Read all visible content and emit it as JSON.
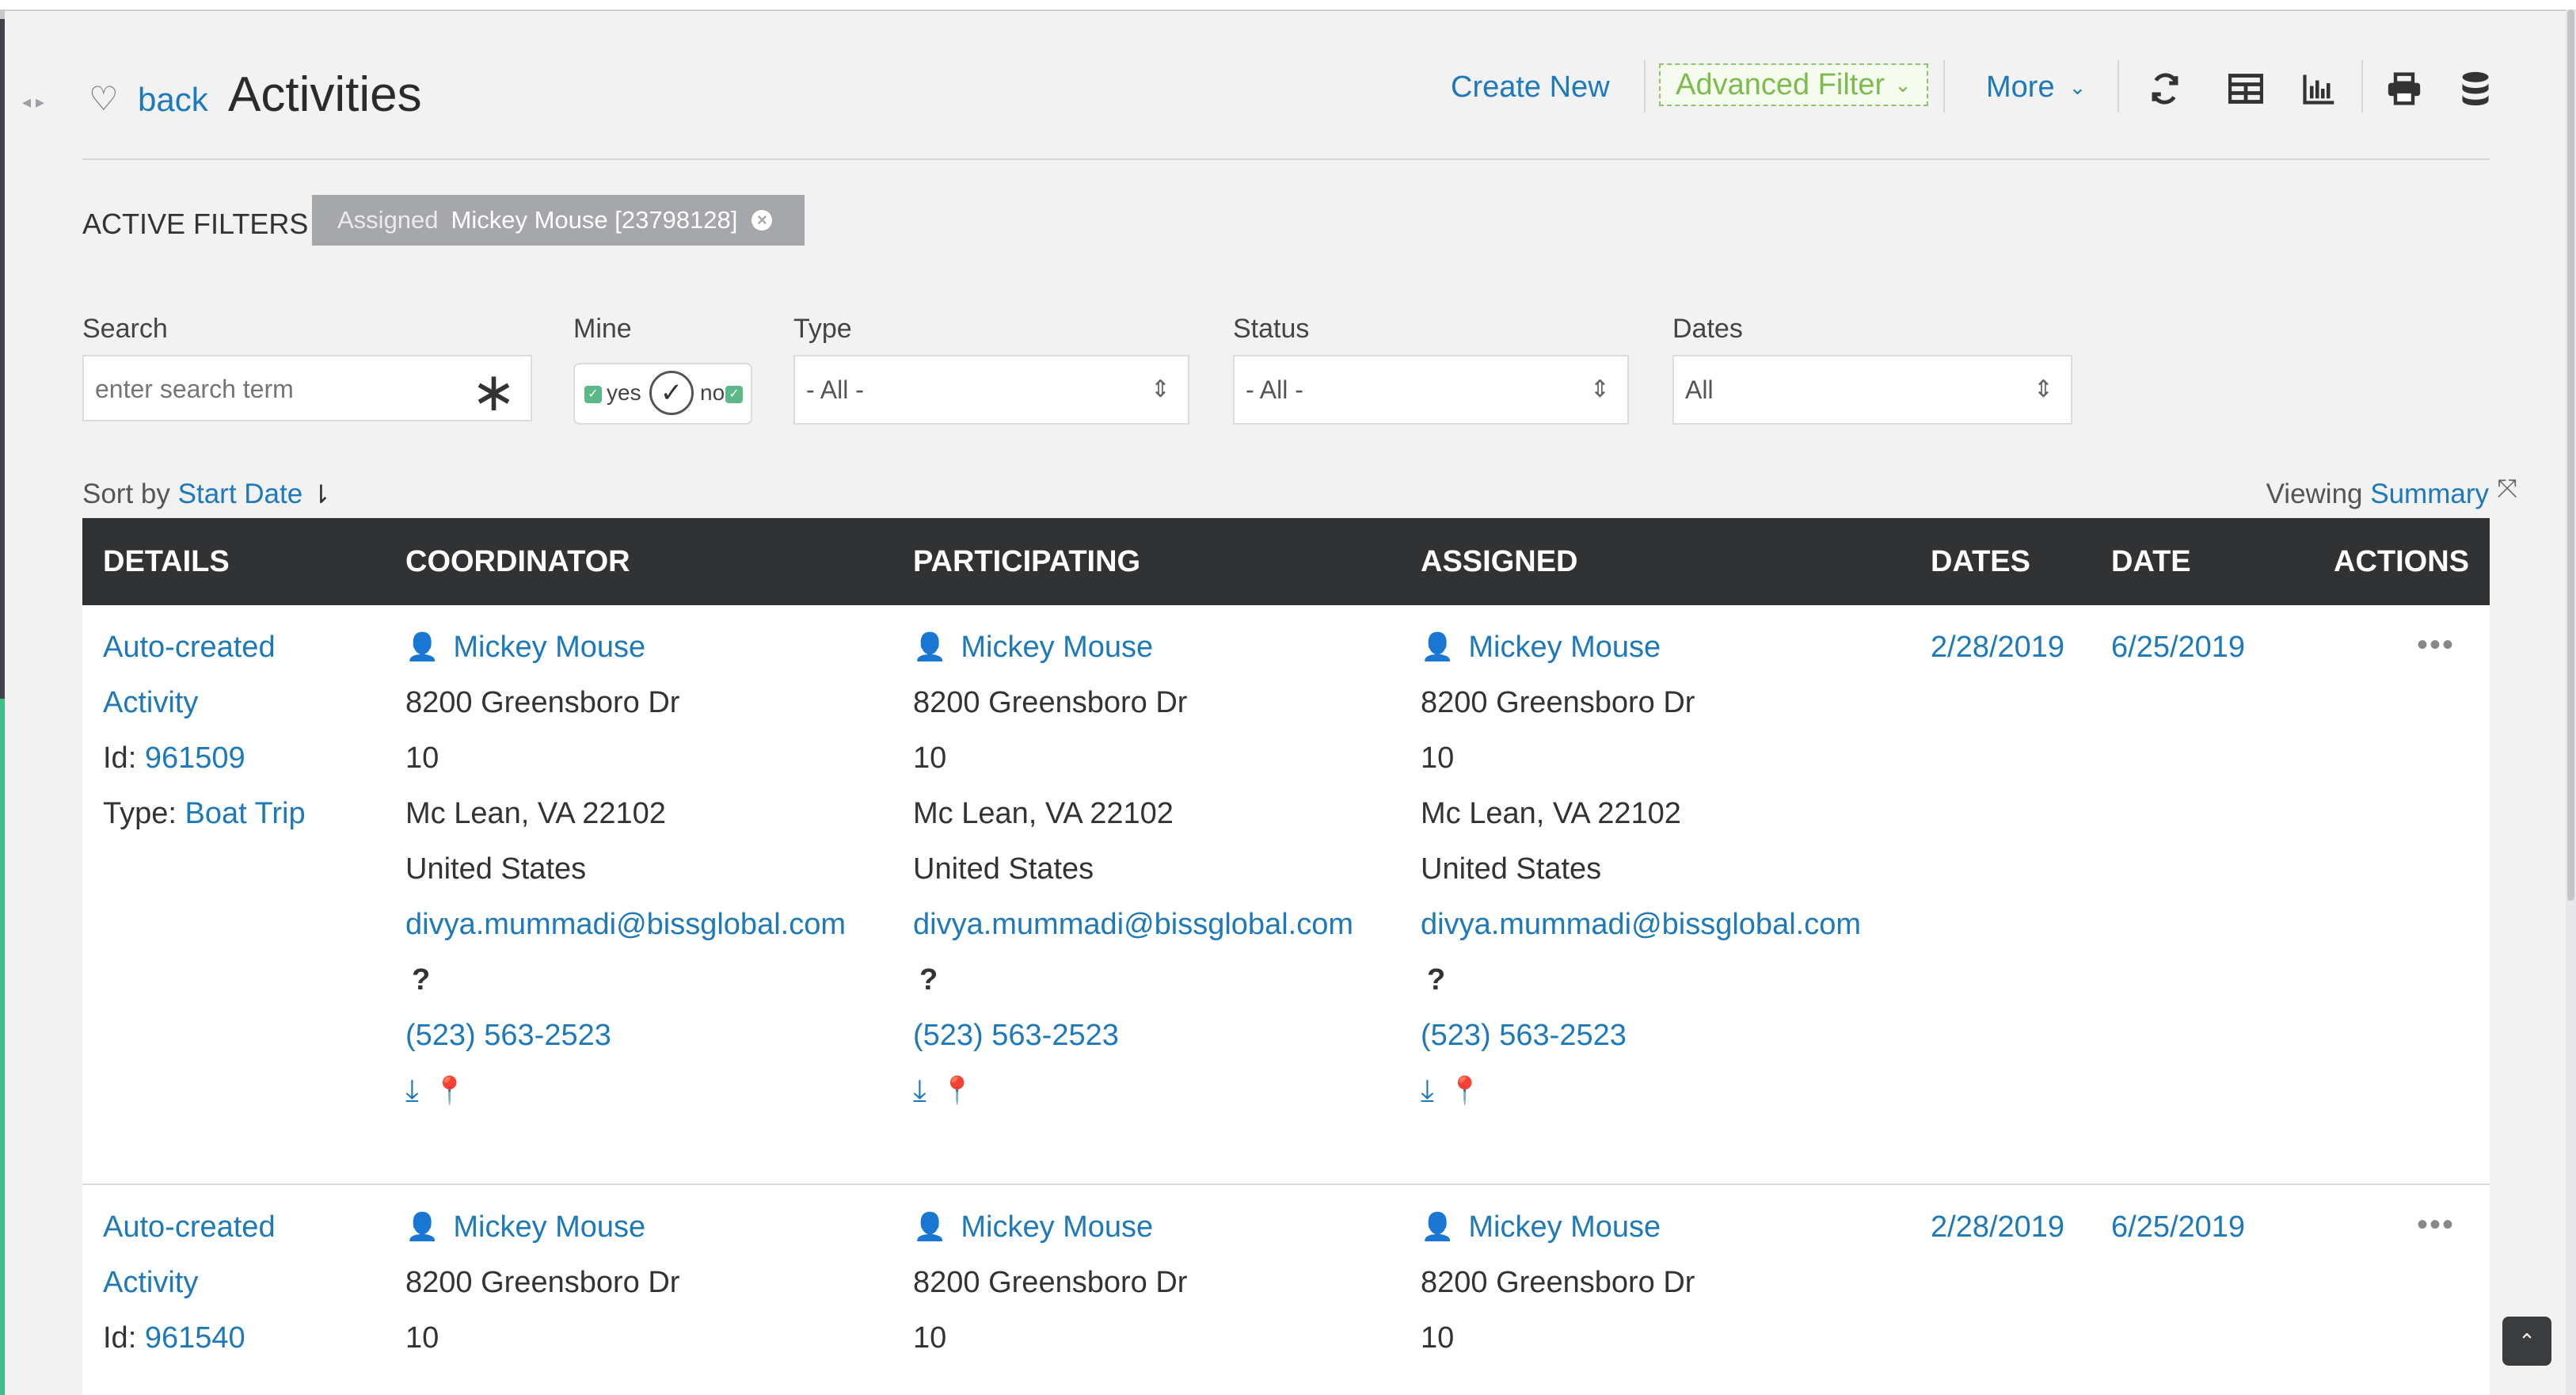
{
  "header": {
    "back_label": "back",
    "title": "Activities"
  },
  "toolbar": {
    "create_new": "Create New",
    "advanced_filter": "Advanced Filter",
    "more": "More",
    "icons": [
      "refresh-icon",
      "grid-view-icon",
      "chart-icon",
      "print-icon",
      "database-icon"
    ]
  },
  "active_filters": {
    "label": "ACTIVE FILTERS",
    "chips": [
      {
        "key": "Assigned",
        "value": "Mickey Mouse [23798128]"
      }
    ]
  },
  "filters": {
    "search": {
      "label": "Search",
      "placeholder": "enter search term"
    },
    "mine": {
      "label": "Mine",
      "yes": "yes",
      "no": "no"
    },
    "type": {
      "label": "Type",
      "value": "- All -"
    },
    "status": {
      "label": "Status",
      "value": "- All -"
    },
    "dates": {
      "label": "Dates",
      "value": "All"
    }
  },
  "sort": {
    "prefix": "Sort by",
    "field": "Start Date"
  },
  "viewing": {
    "prefix": "Viewing",
    "mode": "Summary"
  },
  "table": {
    "columns": [
      "DETAILS",
      "COORDINATOR",
      "PARTICIPATING",
      "ASSIGNED",
      "DATES",
      "DATE",
      "ACTIONS"
    ],
    "rows": [
      {
        "details": {
          "name_line1": "Auto-created",
          "name_line2": "Activity",
          "id_label": "Id:",
          "id": "961509",
          "type_label": "Type:",
          "type": "Boat Trip"
        },
        "contact": {
          "name": "Mickey Mouse",
          "street": "8200 Greensboro Dr",
          "unit": "10",
          "city": "Mc Lean, VA 22102",
          "country": "United States",
          "email": "divya.mummadi@bissglobal.com",
          "unknown": "?",
          "phone": "(523) 563-2523"
        },
        "start_date": "2/28/2019",
        "end_date": "6/25/2019",
        "actions": "•••"
      },
      {
        "details": {
          "name_line1": "Auto-created",
          "name_line2": "Activity",
          "id_label": "Id:",
          "id": "961540"
        },
        "contact": {
          "name": "Mickey Mouse",
          "street": "8200 Greensboro Dr",
          "unit": "10"
        },
        "start_date": "2/28/2019",
        "end_date": "6/25/2019",
        "actions": "•••"
      }
    ]
  },
  "colors": {
    "link": "#1d79b9",
    "header_bg": "#313234",
    "advanced_filter": "#7dbb4f"
  }
}
